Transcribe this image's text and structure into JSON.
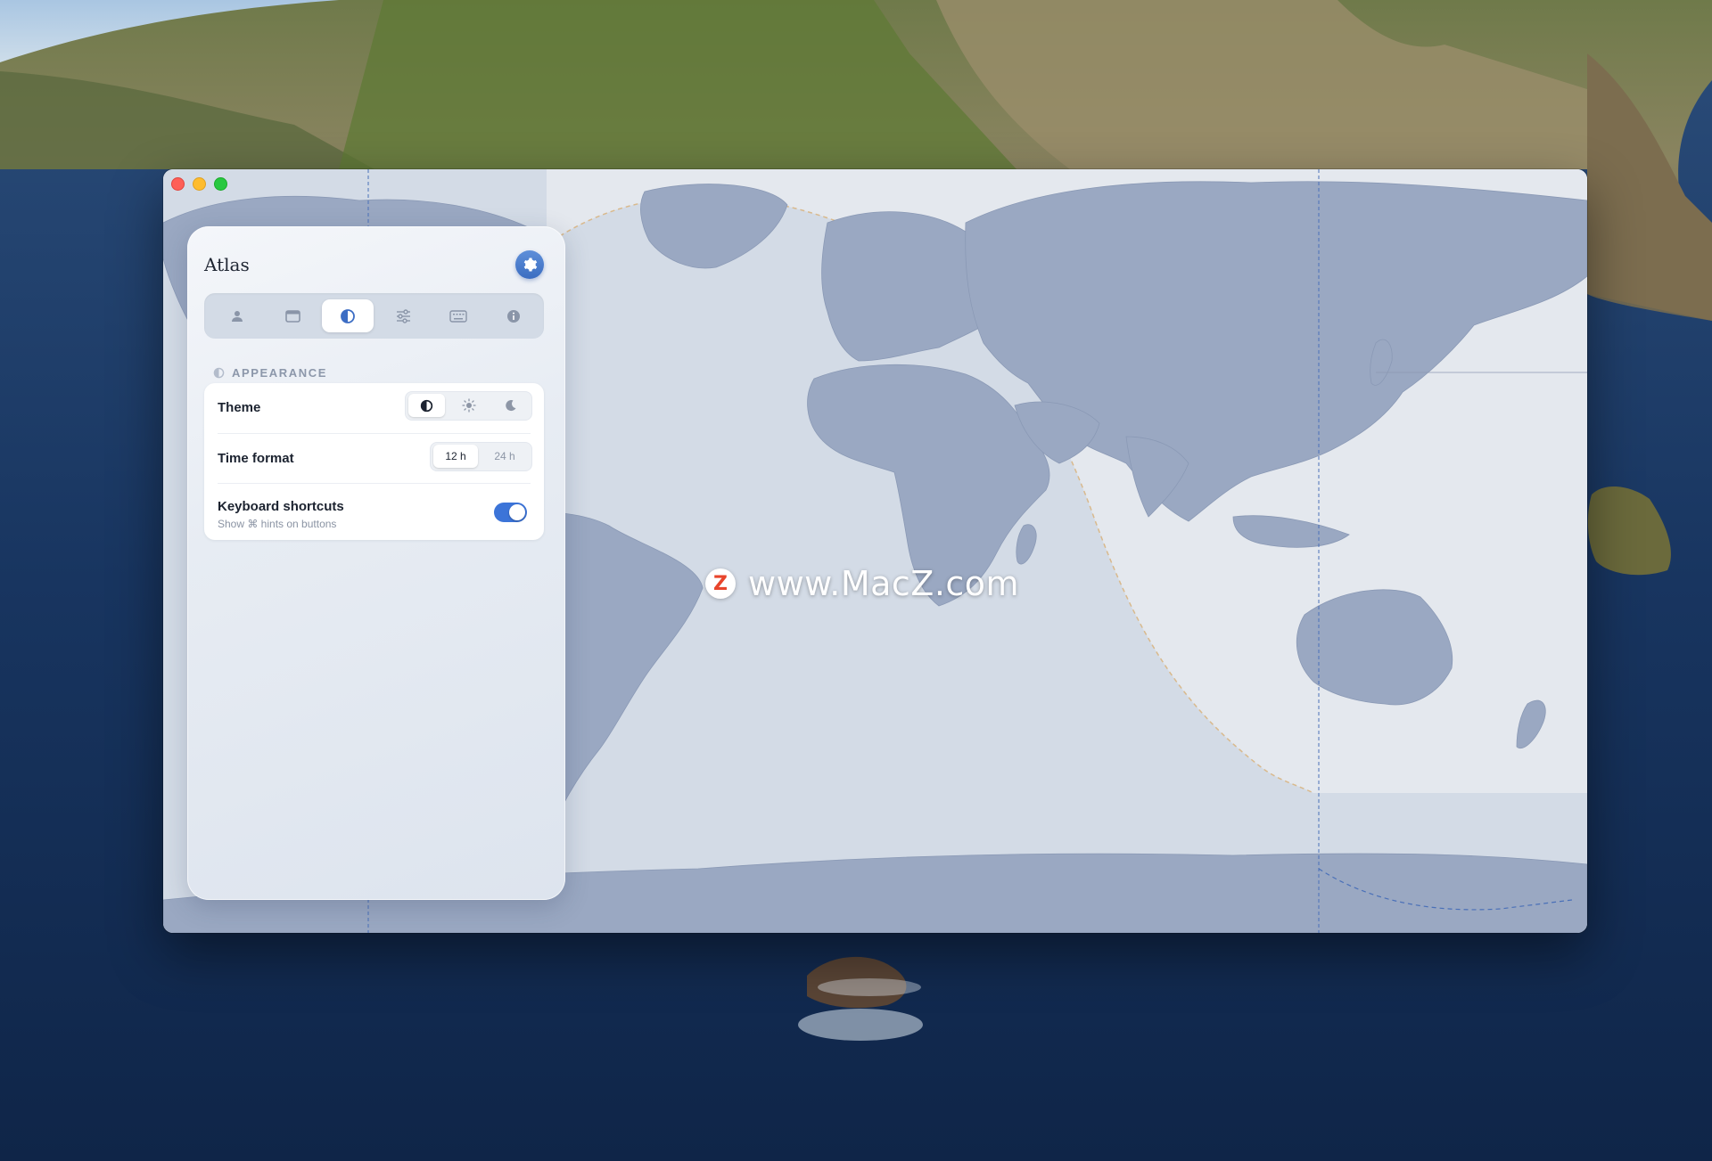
{
  "panel": {
    "title": "Atlas",
    "tabs": [
      {
        "icon": "person-icon"
      },
      {
        "icon": "calendar-icon"
      },
      {
        "icon": "contrast-icon",
        "active": true
      },
      {
        "icon": "sliders-icon"
      },
      {
        "icon": "keyboard-icon"
      },
      {
        "icon": "info-icon"
      }
    ],
    "section": {
      "icon": "contrast-icon",
      "title": "APPEARANCE"
    },
    "rows": {
      "theme": {
        "label": "Theme",
        "options": [
          "auto-contrast-icon",
          "sun-icon",
          "moon-icon"
        ],
        "selected": "auto-contrast-icon"
      },
      "time_format": {
        "label": "Time format",
        "options": [
          "12 h",
          "24 h"
        ],
        "selected": "12 h"
      },
      "keyboard_shortcuts": {
        "label": "Keyboard shortcuts",
        "sublabel": "Show ⌘ hints on buttons",
        "enabled": true
      }
    }
  },
  "watermark": {
    "logo_letter": "Z",
    "text": "www.MacZ.com"
  },
  "colors": {
    "accent": "#3c74d8",
    "map_ocean": "#d3dbe6",
    "map_land": "#9aa8c2",
    "terminator_line": "#d9b98c",
    "toggle_on": "#3c74d8"
  }
}
